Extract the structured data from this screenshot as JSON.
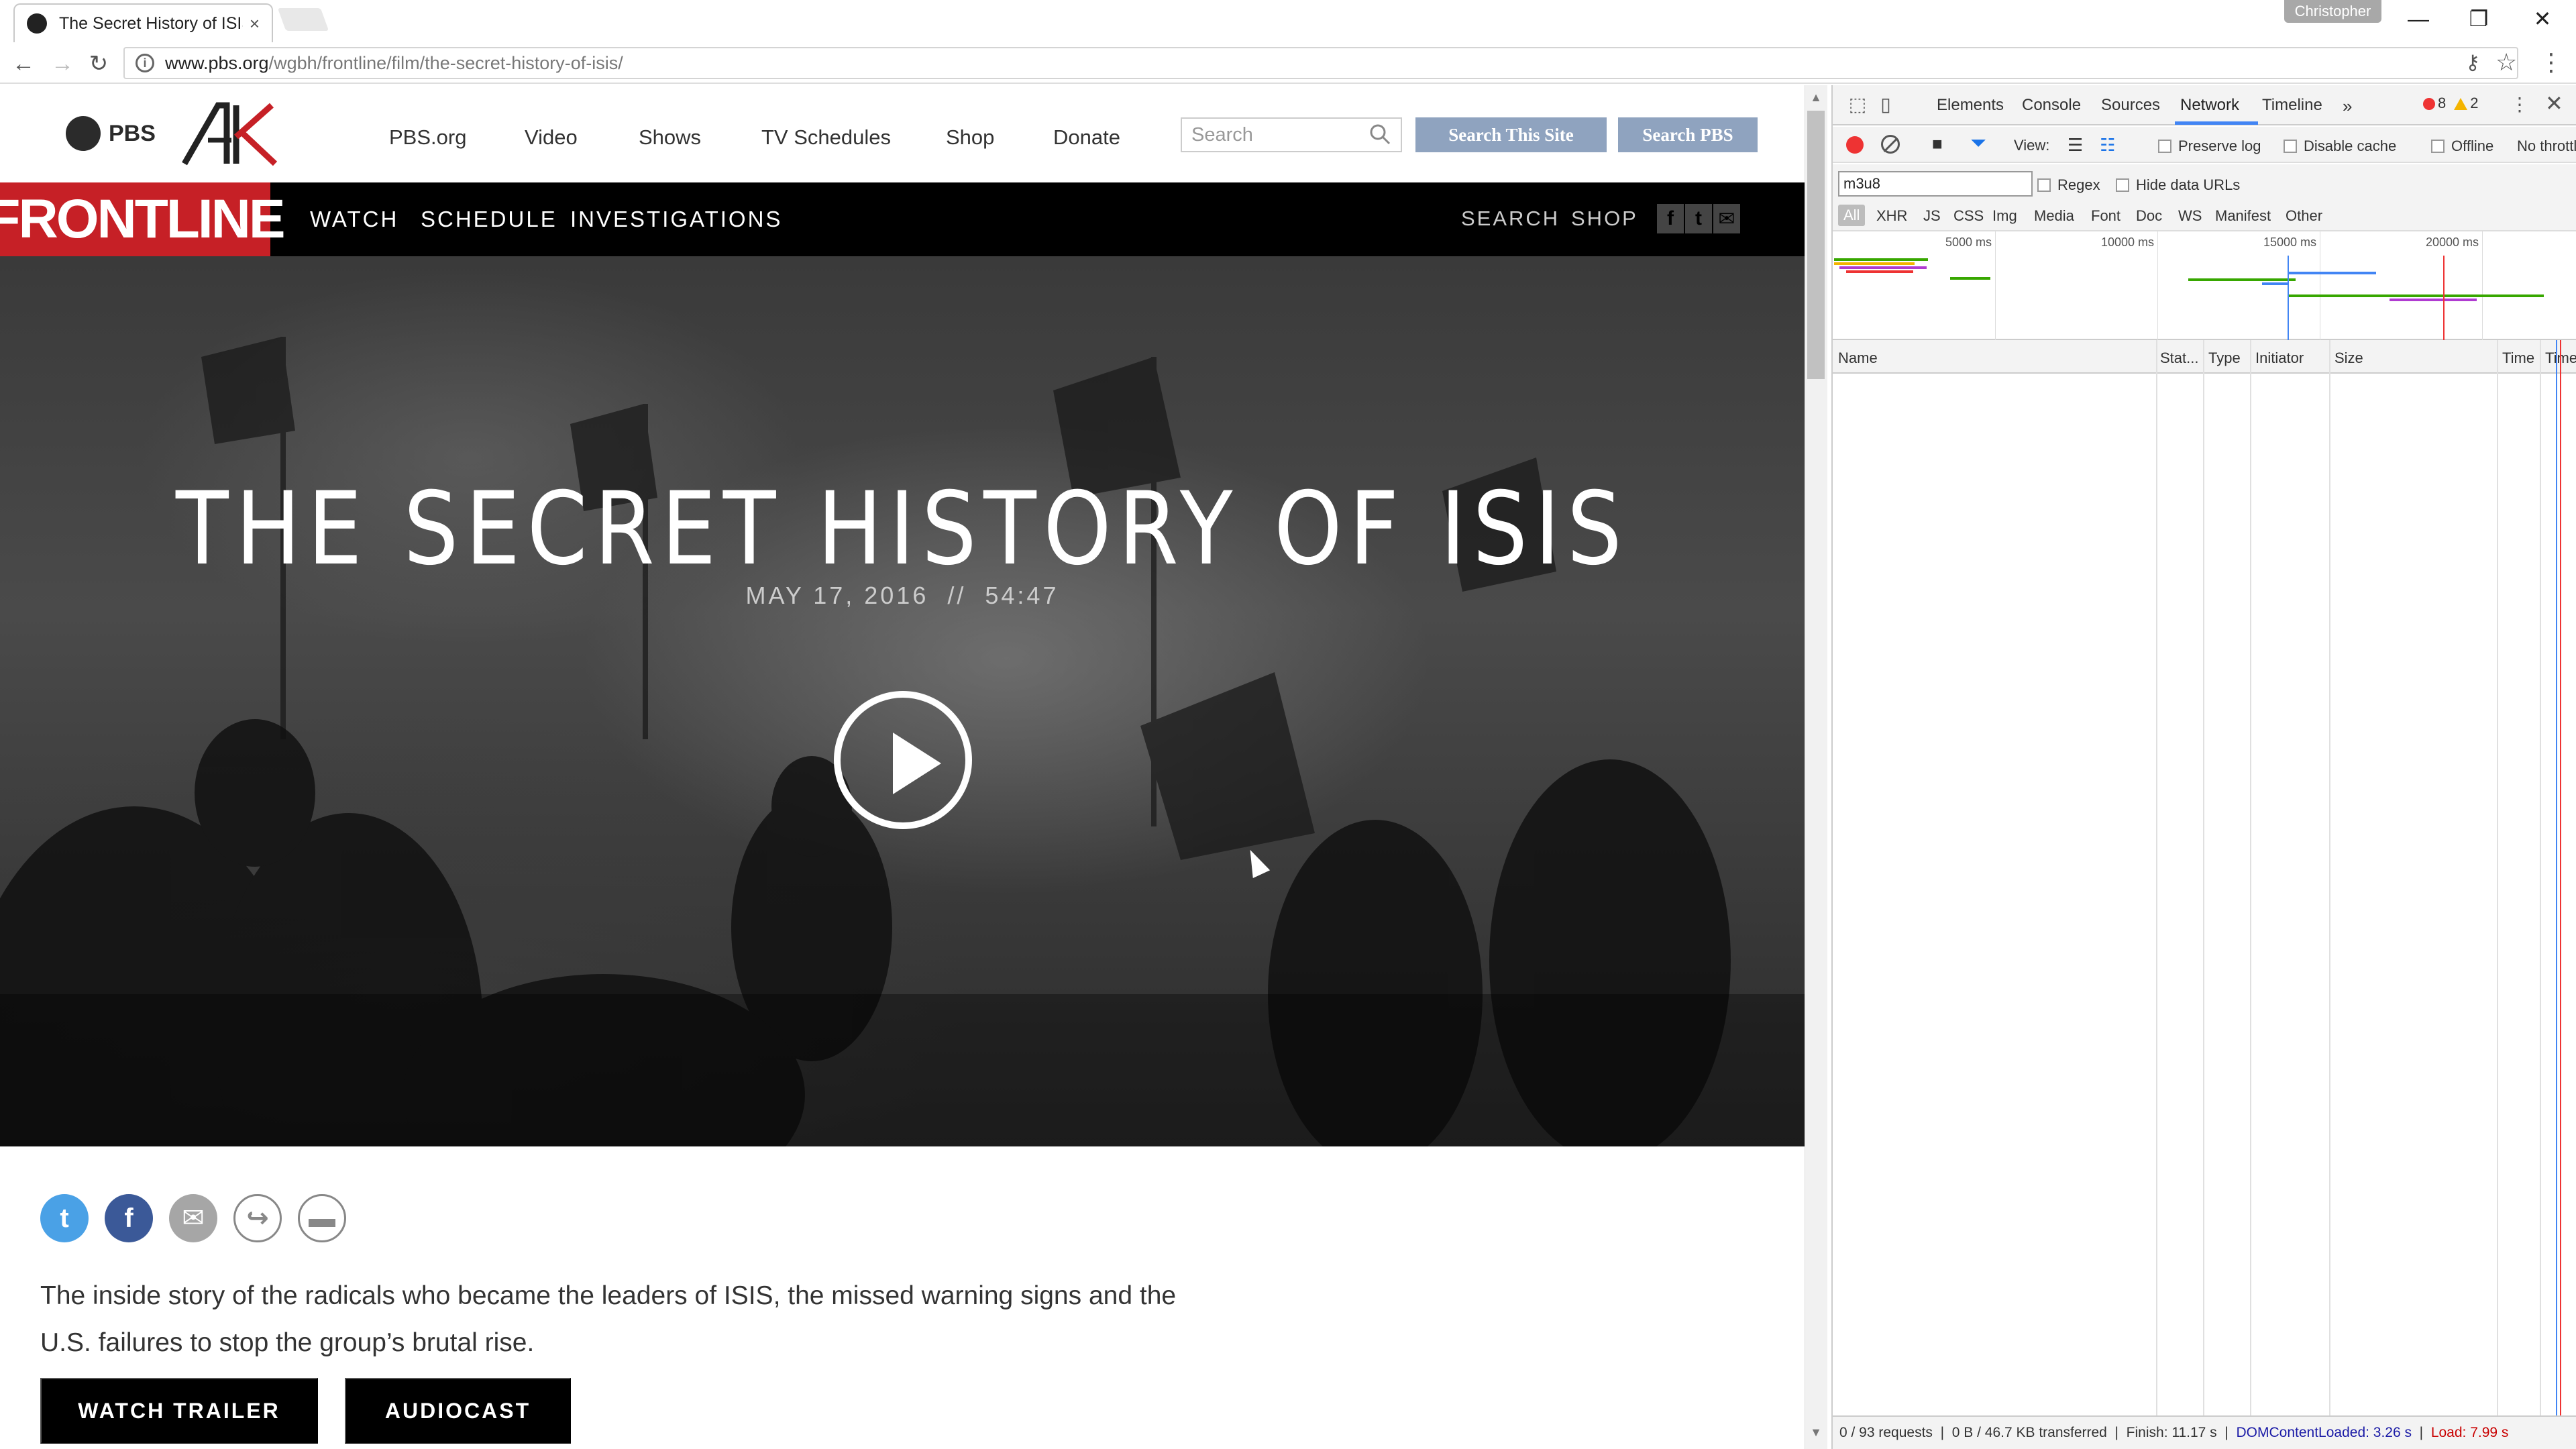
{
  "browser": {
    "tab_title": "The Secret History of ISIS",
    "tab_close": "×",
    "profile_name": "Christopher",
    "window_controls": {
      "minimize": "—",
      "maximize": "❐",
      "close": "✕"
    },
    "url_host": "www.pbs.org",
    "url_path": "/wgbh/frontline/film/the-secret-history-of-isis/",
    "icons": {
      "back": "←",
      "forward": "→",
      "reload": "↻",
      "info": "i",
      "key": "⚷",
      "star": "☆",
      "menu": "⋮"
    }
  },
  "pbs_header": {
    "logo_text": "PBS",
    "nav": [
      "PBS.org",
      "Video",
      "Shows",
      "TV Schedules",
      "Shop",
      "Donate"
    ],
    "search_placeholder": "Search",
    "search_site_button": "Search This Site",
    "search_pbs_button": "Search PBS"
  },
  "frontline_nav": {
    "logo": "FRONTLINE",
    "items": [
      "WATCH",
      "SCHEDULE",
      "INVESTIGATIONS"
    ],
    "right_items": [
      "SEARCH",
      "SHOP"
    ],
    "social": [
      "f",
      "t",
      "✉"
    ]
  },
  "hero": {
    "title": "THE SECRET HISTORY OF ISIS",
    "date": "MAY 17, 2016",
    "separator": "//",
    "duration": "54:47"
  },
  "share": {
    "twitter": "t",
    "facebook": "f",
    "email": "✉",
    "forward": "↪",
    "comment": "▬"
  },
  "description": "The inside story of the radicals who became the leaders of ISIS, the missed warning signs and the U.S. failures to stop the group’s brutal rise.",
  "buttons": {
    "trailer": "WATCH TRAILER",
    "audiocast": "AUDIOCAST"
  },
  "devtools": {
    "tabs": [
      "Elements",
      "Console",
      "Sources",
      "Network",
      "Timeline"
    ],
    "active_tab": "Network",
    "more": "»",
    "error_count": "8",
    "warning_count": "2",
    "kebab": "⋮",
    "close": "✕",
    "view_label": "View:",
    "preserve_log": "Preserve log",
    "disable_cache": "Disable cache",
    "offline": "Offline",
    "throttling": "No throttling",
    "filter_value": "m3u8",
    "regex": "Regex",
    "hide_data_urls": "Hide data URLs",
    "types": [
      "All",
      "XHR",
      "JS",
      "CSS",
      "Img",
      "Media",
      "Font",
      "Doc",
      "WS",
      "Manifest",
      "Other"
    ],
    "overview_ticks": [
      "5000 ms",
      "10000 ms",
      "15000 ms",
      "20000 ms"
    ],
    "columns": [
      "Name",
      "Stat...",
      "Type",
      "Initiator",
      "Size",
      "Time",
      "Time"
    ],
    "status": {
      "requests": "0 / 93 requests",
      "transferred": "0 B / 46.7 KB transferred",
      "finish": "Finish: 11.17 s",
      "dom_content_loaded": "DOMContentLoaded: 3.26 s",
      "load": "Load: 7.99 s",
      "sep": "|"
    },
    "colors": {
      "accent": "#4285f4",
      "record": "#ee3333"
    }
  }
}
